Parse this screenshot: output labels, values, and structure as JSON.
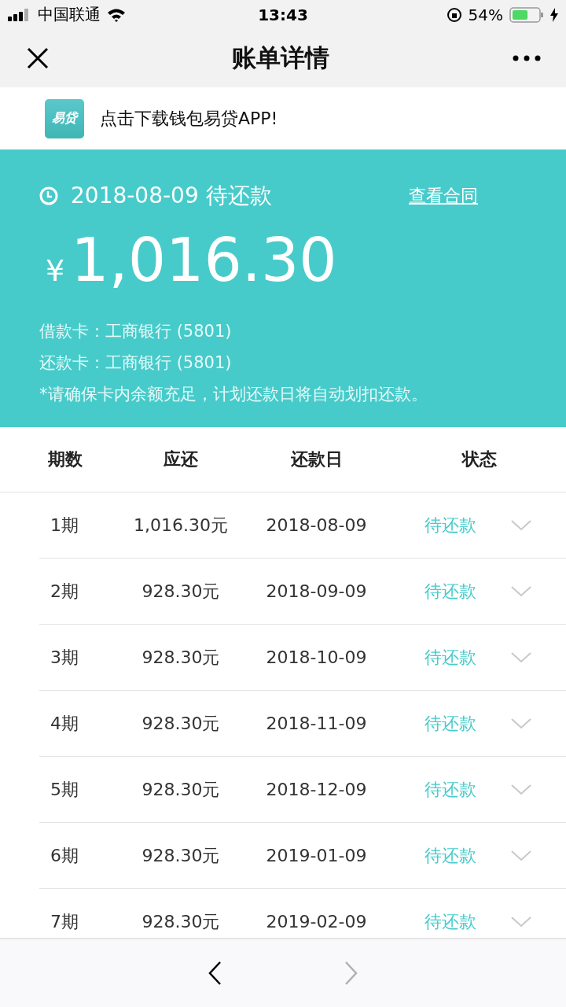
{
  "status_bar": {
    "carrier": "中国联通",
    "time": "13:43",
    "battery": "54%"
  },
  "nav": {
    "title": "账单详情"
  },
  "banner": {
    "logo_text": "易贷",
    "text": "点击下载钱包易贷APP!"
  },
  "summary": {
    "due": "2018-08-09 待还款",
    "contract_link": "查看合同",
    "currency": "¥",
    "amount": "1,016.30",
    "cards": [
      "借款卡：工商银行 (5801)",
      "还款卡：工商银行 (5801)"
    ],
    "note": "*请确保卡内余额充足，计划还款日将自动划扣还款。"
  },
  "table": {
    "columns": [
      "期数",
      "应还",
      "还款日",
      "状态"
    ],
    "rows": [
      {
        "period": "1期",
        "amount": "1,016.30元",
        "date": "2018-08-09",
        "status": "待还款",
        "expanded": false
      },
      {
        "period": "2期",
        "amount": "928.30元",
        "date": "2018-09-09",
        "status": "待还款",
        "expanded": false
      },
      {
        "period": "3期",
        "amount": "928.30元",
        "date": "2018-10-09",
        "status": "待还款",
        "expanded": false
      },
      {
        "period": "4期",
        "amount": "928.30元",
        "date": "2018-11-09",
        "status": "待还款",
        "expanded": false
      },
      {
        "period": "5期",
        "amount": "928.30元",
        "date": "2018-12-09",
        "status": "待还款",
        "expanded": false
      },
      {
        "period": "6期",
        "amount": "928.30元",
        "date": "2019-01-09",
        "status": "待还款",
        "expanded": false
      },
      {
        "period": "7期",
        "amount": "928.30元",
        "date": "2019-02-09",
        "status": "待还款",
        "expanded": false
      }
    ]
  },
  "bottom_bar": {
    "back_disabled": false,
    "forward_disabled": true
  }
}
